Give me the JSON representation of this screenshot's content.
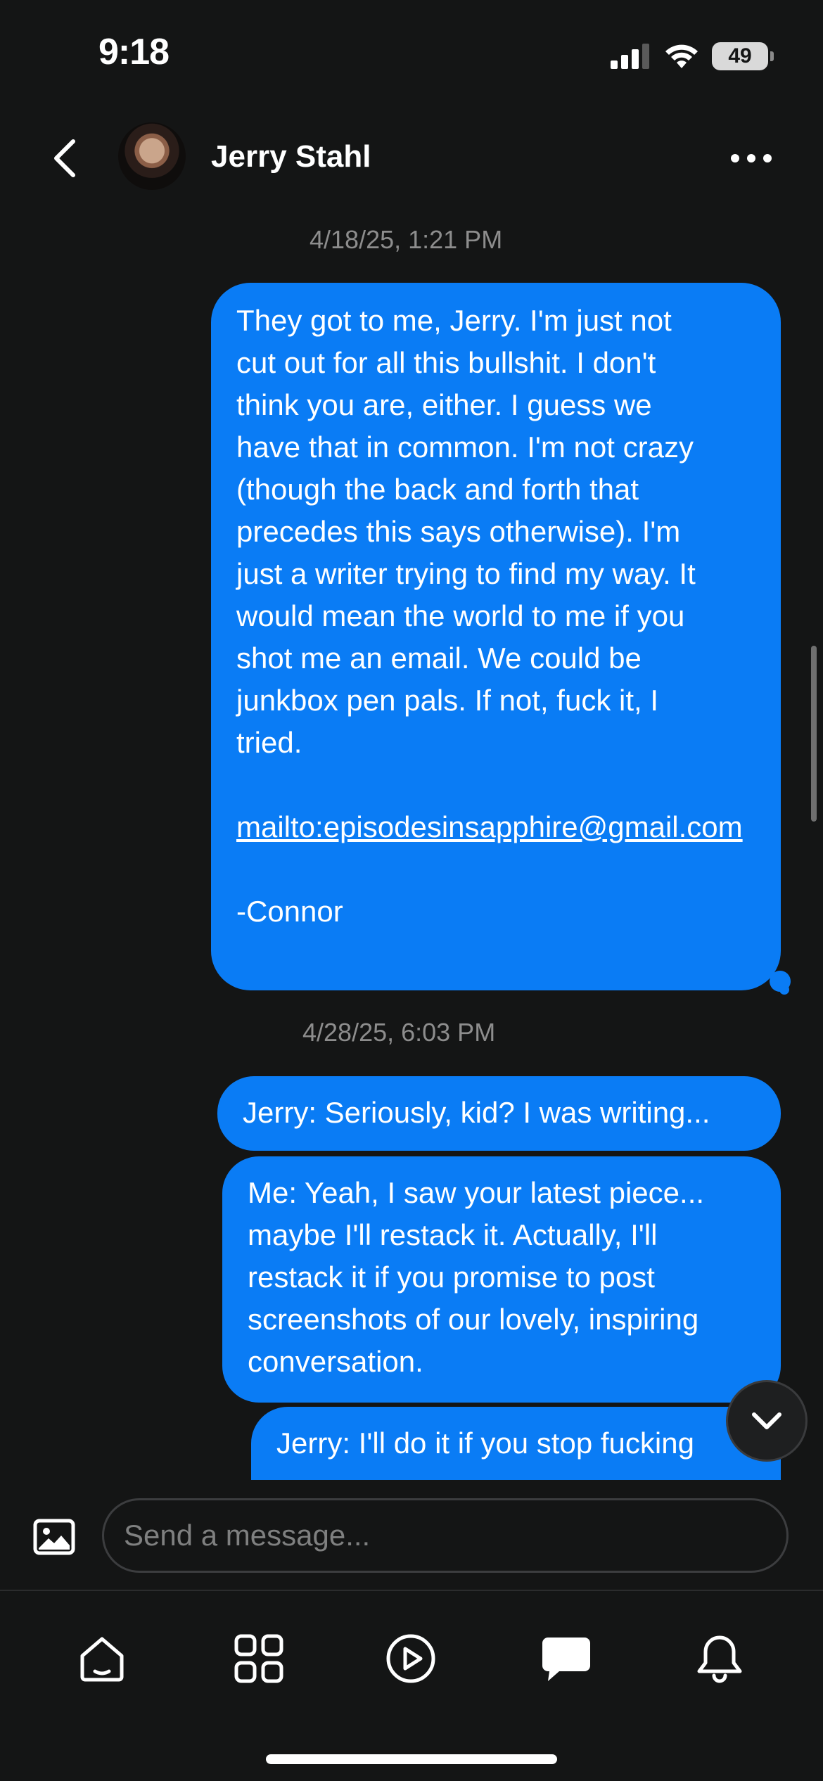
{
  "status_bar": {
    "time": "9:18",
    "battery": "49"
  },
  "header": {
    "contact_name": "Jerry Stahl"
  },
  "messages": [
    {
      "timestamp": "4/18/25, 1:21 PM"
    },
    {
      "lines": [
        "They got to me, Jerry. I'm just not",
        "cut out for all this bullshit. I don't",
        "think you are, either. I guess we",
        "have that in common. I'm not crazy",
        "(though the back and forth that",
        "precedes this says otherwise). I'm",
        "just a writer trying to find my way. It",
        "would mean the world to me if you",
        "shot me an email. We could be",
        "junkbox pen pals. If not, fuck it, I",
        "tried."
      ],
      "link": "mailto:episodesinsapphire@gmail.com",
      "signature": "-Connor"
    },
    {
      "timestamp": "4/28/25, 6:03 PM"
    },
    {
      "text": "Jerry: Seriously, kid? I was writing..."
    },
    {
      "text": "Me: Yeah, I saw your latest piece... maybe I'll restack it. Actually, I'll restack it if you promise to post screenshots of our lovely, inspiring conversation."
    },
    {
      "text": "Jerry: I'll do it if you stop fucking"
    }
  ],
  "composer": {
    "placeholder": "Send a message..."
  },
  "icons": {
    "back": "chevron-left-icon",
    "more": "more-horizontal-icon",
    "scroll_down": "chevron-down-icon",
    "image": "image-icon",
    "tabs": [
      "home-icon",
      "grid-icon",
      "play-icon",
      "chat-icon",
      "bell-icon"
    ]
  },
  "colors": {
    "background": "#141515",
    "bubble": "#0a7cf5"
  }
}
